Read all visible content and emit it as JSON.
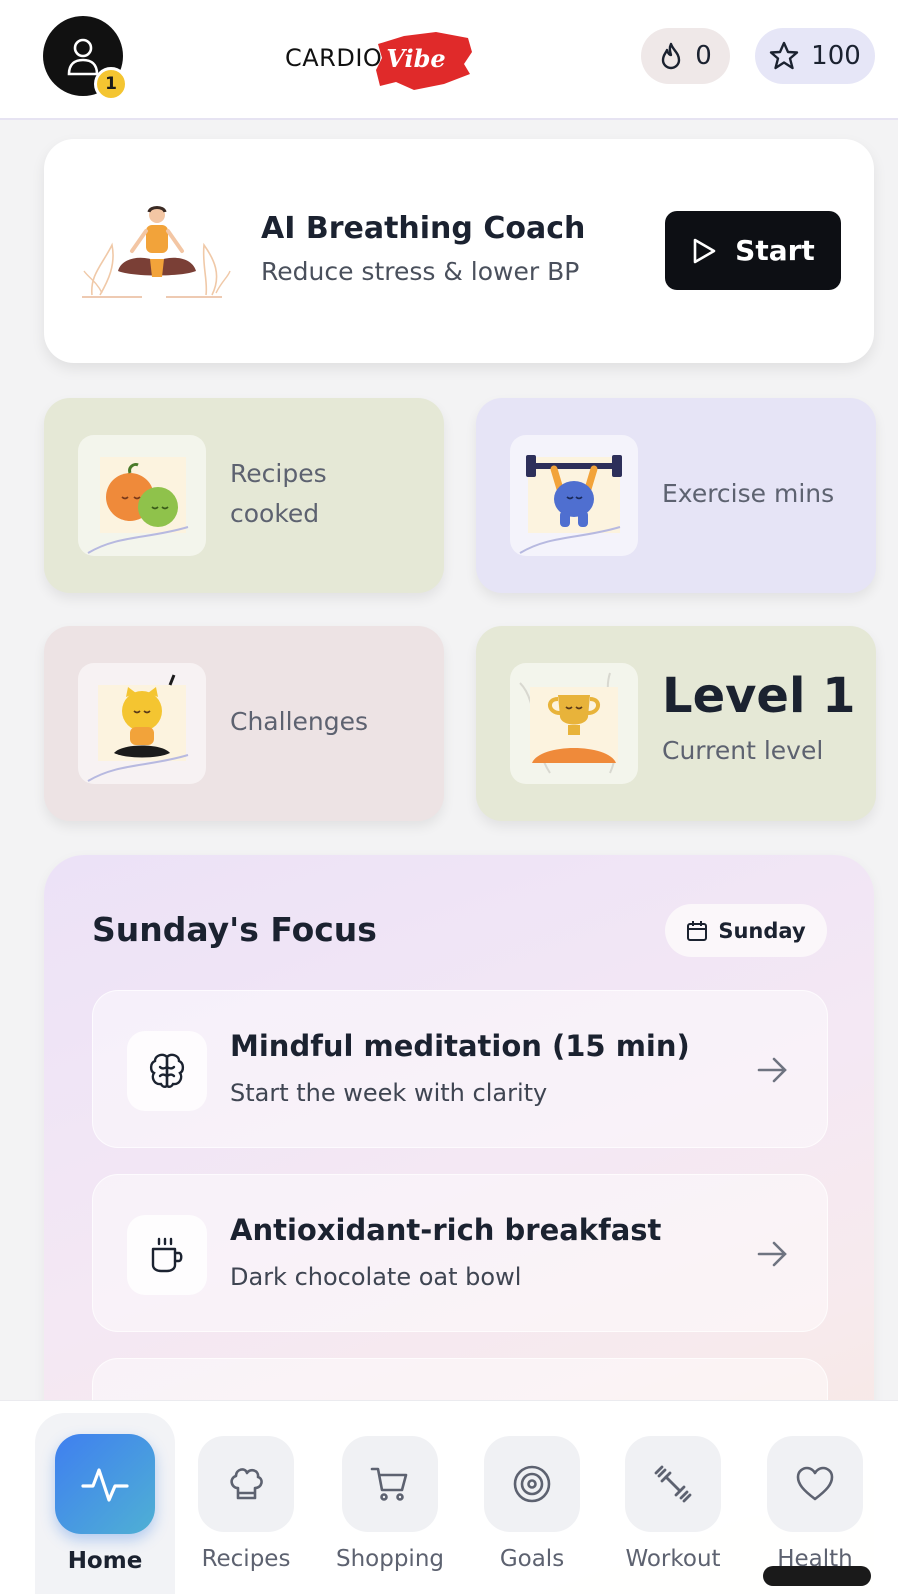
{
  "header": {
    "avatar_badge": "1",
    "logo_left": "CARDIO",
    "logo_right": "Vibe",
    "streak_count": "0",
    "points": "100"
  },
  "coach": {
    "title": "AI Breathing Coach",
    "subtitle": "Reduce stress & lower BP",
    "start_label": "Start"
  },
  "tiles": {
    "recipes_label": "Recipes cooked",
    "exercise_label": "Exercise mins",
    "challenges_label": "Challenges",
    "level_value": "Level 1",
    "level_label": "Current level"
  },
  "focus": {
    "title": "Sunday's Focus",
    "day_chip": "Sunday",
    "items": [
      {
        "title": "Mindful meditation (15 min)",
        "subtitle": "Start the week with clarity",
        "icon": "brain-icon"
      },
      {
        "title": "Antioxidant-rich breakfast",
        "subtitle": "Dark chocolate oat bowl",
        "icon": "coffee-cup-icon"
      }
    ]
  },
  "nav": {
    "items": [
      {
        "label": "Home",
        "icon": "activity-pulse-icon",
        "active": true
      },
      {
        "label": "Recipes",
        "icon": "chef-hat-icon"
      },
      {
        "label": "Shopping",
        "icon": "shopping-cart-icon"
      },
      {
        "label": "Goals",
        "icon": "target-icon"
      },
      {
        "label": "Workout",
        "icon": "dumbbell-icon"
      },
      {
        "label": "Health",
        "icon": "heart-icon"
      }
    ]
  },
  "colors": {
    "accent_blue": "#3f7ff0",
    "tile_green": "#e5e8d6",
    "tile_lavender": "#e6e4f6",
    "tile_rose": "#ede3e4",
    "badge_yellow": "#f4c531"
  }
}
